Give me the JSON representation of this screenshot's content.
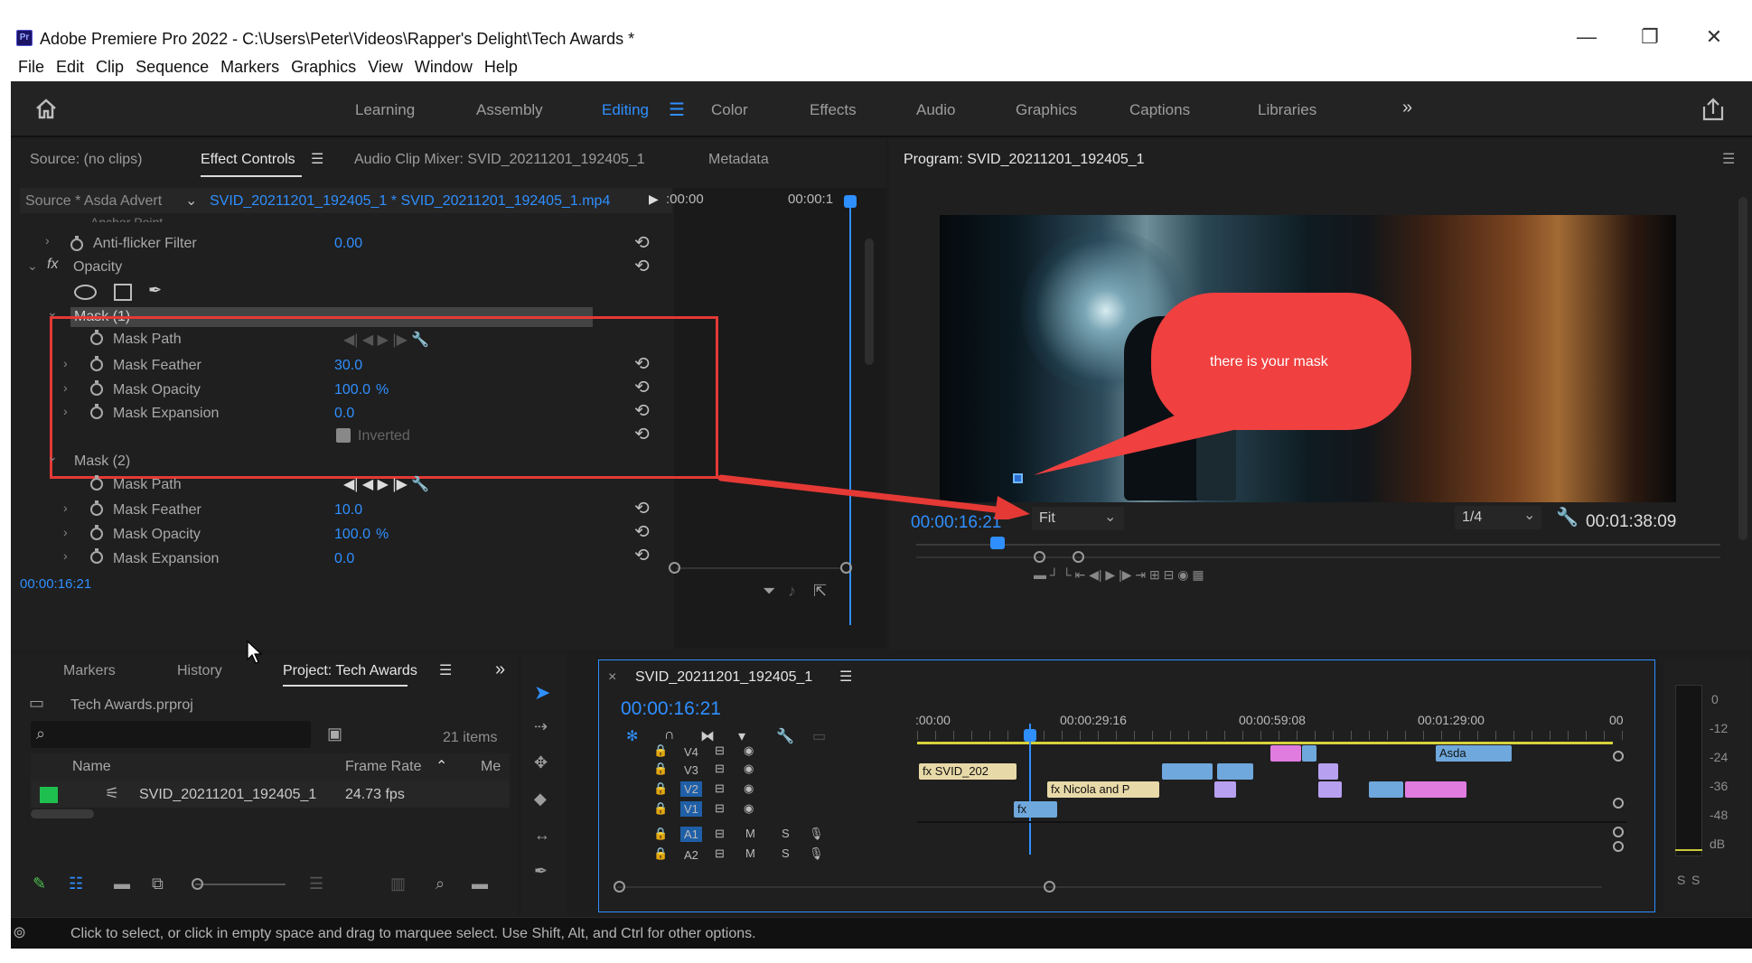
{
  "window": {
    "title": "Adobe Premiere Pro 2022 - C:\\Users\\Peter\\Videos\\Rapper's Delight\\Tech Awards *",
    "app_icon": "Pr",
    "minimize": "—",
    "maximize": "❐",
    "close": "✕"
  },
  "menu": [
    "File",
    "Edit",
    "Clip",
    "Sequence",
    "Markers",
    "Graphics",
    "View",
    "Window",
    "Help"
  ],
  "workspaces": [
    "Learning",
    "Assembly",
    "Editing",
    "Color",
    "Effects",
    "Audio",
    "Graphics",
    "Captions",
    "Libraries"
  ],
  "workspace_more": "»",
  "effect_panel": {
    "tabs": [
      "Source: (no clips)",
      "Effect Controls",
      "Audio Clip Mixer: SVID_20211201_192405_1",
      "Metadata"
    ],
    "source_label": "Source * Asda Advert",
    "clip_label": "SVID_20211201_192405_1 * SVID_20211201_192405_1.mp4",
    "ruler_start": ":00:00",
    "ruler_end": "00:00:1",
    "partial_row": "Anchor Point",
    "antiflicker": {
      "label": "Anti-flicker Filter",
      "value": "0.00"
    },
    "opacity_label": "Opacity",
    "fx": "fx",
    "mask1": {
      "title": "Mask (1)",
      "rows": [
        {
          "label": "Mask Path"
        },
        {
          "label": "Mask Feather",
          "value": "30.0"
        },
        {
          "label": "Mask Opacity",
          "value": "100.0",
          "unit": "%"
        },
        {
          "label": "Mask Expansion",
          "value": "0.0"
        }
      ],
      "inverted": "Inverted"
    },
    "mask2": {
      "title": "Mask (2)",
      "rows": [
        {
          "label": "Mask Path"
        },
        {
          "label": "Mask Feather",
          "value": "10.0"
        },
        {
          "label": "Mask Opacity",
          "value": "100.0",
          "unit": "%"
        },
        {
          "label": "Mask Expansion",
          "value": "0.0"
        }
      ]
    },
    "timecode": "00:00:16:21"
  },
  "program": {
    "title": "Program: SVID_20211201_192405_1",
    "timecode": "00:00:16:21",
    "fit": "Fit",
    "resolution": "1/4",
    "duration": "00:01:38:09",
    "callout": "there is your mask"
  },
  "project": {
    "tabs": [
      "Markers",
      "History",
      "Project: Tech Awards"
    ],
    "file": "Tech Awards.prproj",
    "items": "21 items",
    "search_placeholder": "",
    "columns": [
      "Name",
      "Frame Rate",
      "Me"
    ],
    "row": {
      "name": "SVID_20211201_192405_1",
      "fps": "24.73 fps"
    }
  },
  "timeline": {
    "title": "SVID_20211201_192405_1",
    "timecode": "00:00:16:21",
    "ruler": [
      ":00:00",
      "00:00:29:16",
      "00:00:59:08",
      "00:01:29:00",
      "00"
    ],
    "tracks": [
      {
        "name": "V4"
      },
      {
        "name": "V3"
      },
      {
        "name": "V2",
        "active": true
      },
      {
        "name": "V1",
        "active": true
      },
      {
        "name": "A1",
        "active": true
      },
      {
        "name": "A2"
      }
    ],
    "clips": {
      "svid": "SVID_202",
      "nicola": "Nicola and P",
      "asda": "Asda",
      "fx": "fx"
    },
    "m": "M",
    "s": "S"
  },
  "meter": {
    "scale": [
      "0",
      "-12",
      "-24",
      "-36",
      "-48",
      "dB"
    ],
    "solo": [
      "S",
      "S"
    ]
  },
  "status": "Click to select, or click in empty space and drag to marquee select. Use Shift, Alt, and Ctrl for other options.",
  "colors": {
    "accent": "#2f8fff",
    "annotation": "#e53935",
    "callout": "#f04040"
  }
}
